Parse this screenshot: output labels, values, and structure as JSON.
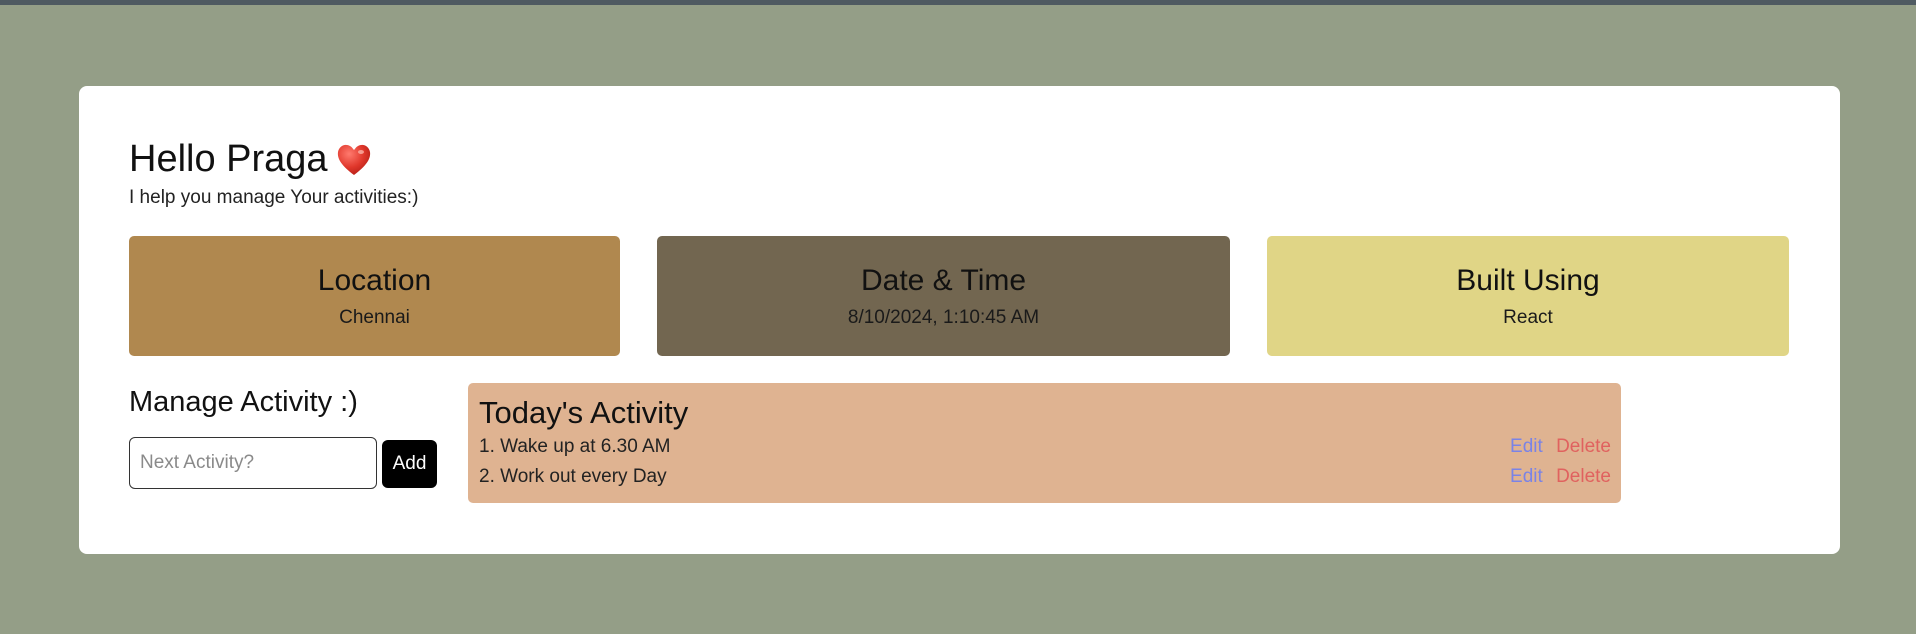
{
  "header": {
    "greeting": "Hello Praga",
    "subtitle": "I help you manage Your activities:)"
  },
  "info_cards": [
    {
      "title": "Location",
      "value": "Chennai",
      "color": "#b0884f"
    },
    {
      "title": "Date & Time",
      "value": "8/10/2024, 1:10:45 AM",
      "color": "#726650"
    },
    {
      "title": "Built Using",
      "value": "React",
      "color": "#e0d586"
    }
  ],
  "manage": {
    "title": "Manage Activity :)",
    "input_placeholder": "Next Activity?",
    "input_value": "",
    "add_label": "Add"
  },
  "today": {
    "title": "Today's Activity",
    "color": "#dfb391",
    "items": [
      {
        "text": "1. Wake up at 6.30 AM",
        "edit_label": "Edit",
        "delete_label": "Delete"
      },
      {
        "text": "2. Work out every Day",
        "edit_label": "Edit",
        "delete_label": "Delete"
      }
    ]
  },
  "colors": {
    "page_background": "#949e87",
    "top_bar": "#4f5a61",
    "edit_link": "#7a83e6",
    "delete_link": "#e0625f"
  },
  "icons": {
    "greeting_icon": "heart-icon"
  }
}
